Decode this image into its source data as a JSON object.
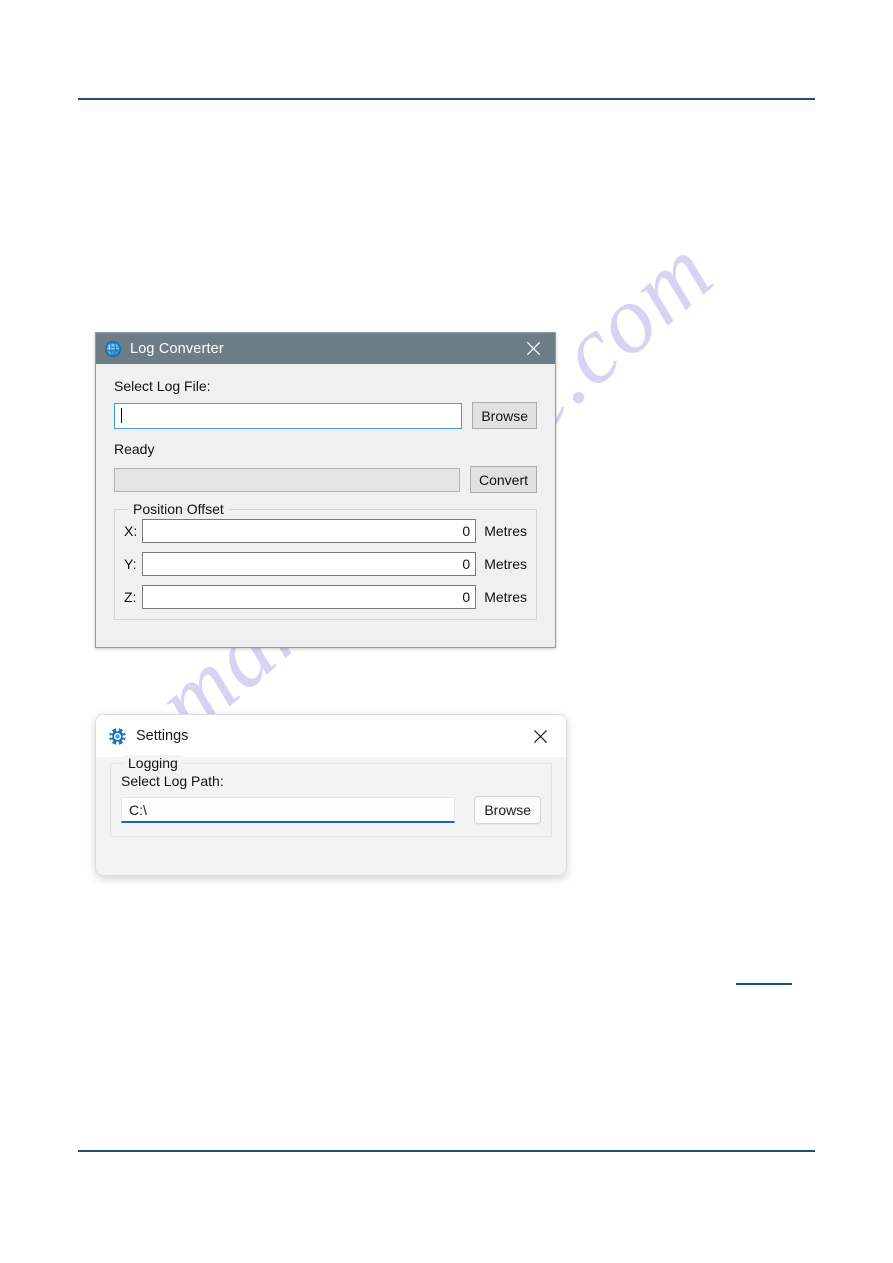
{
  "page": {
    "background_color": "#ffffff",
    "rule_color": "#1f4e79",
    "mini_rule_color": "#13566b",
    "watermark_text": "manualshive.com",
    "watermark_color": "#c9c5ef"
  },
  "log_converter": {
    "title": "Log Converter",
    "titlebar_color": "#6c7d86",
    "icon": "globe-icon",
    "close_label": "✕",
    "select_log_file_label": "Select Log File:",
    "log_file_value": "",
    "browse_label": "Browse",
    "status_label": "Ready",
    "progress_value": "",
    "convert_label": "Convert",
    "position_offset": {
      "legend": "Position Offset",
      "unit": "Metres",
      "axes": [
        {
          "label": "X:",
          "value": "0"
        },
        {
          "label": "Y:",
          "value": "0"
        },
        {
          "label": "Z:",
          "value": "0"
        }
      ]
    }
  },
  "settings": {
    "title": "Settings",
    "icon": "gear-icon",
    "accent_color": "#1266b5",
    "close_label": "✕",
    "logging_legend": "Logging",
    "select_log_path_label": "Select Log Path:",
    "log_path_value": "C:\\",
    "browse_label": "Browse"
  }
}
